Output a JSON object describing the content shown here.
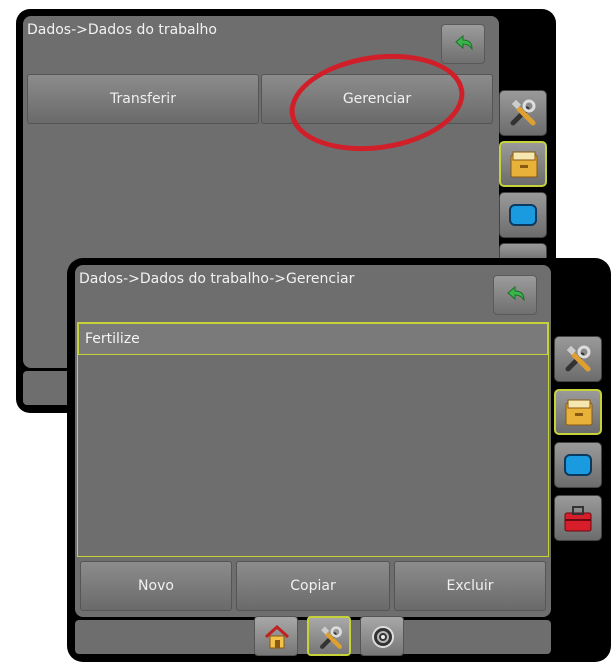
{
  "back_screen": {
    "title": "Dados->Dados do trabalho",
    "buttons": {
      "transfer": "Transferir",
      "manage": "Gerenciar"
    }
  },
  "front_screen": {
    "title": "Dados->Dados do trabalho->Gerenciar",
    "jobs": [
      "Fertilize"
    ],
    "buttons": {
      "new": "Novo",
      "copy": "Copiar",
      "delete": "Excluir"
    }
  },
  "colors": {
    "selection_accent": "#c6d23a",
    "callout_ring": "#d11f2a",
    "panel_background": "#6e6e6e"
  },
  "icons": {
    "back": "back-arrow-icon",
    "tools": "tools-icon",
    "data": "data-storage-icon",
    "display": "display-icon",
    "toolbox": "toolbox-icon",
    "home": "home-icon",
    "gauge": "gauge-icon"
  }
}
